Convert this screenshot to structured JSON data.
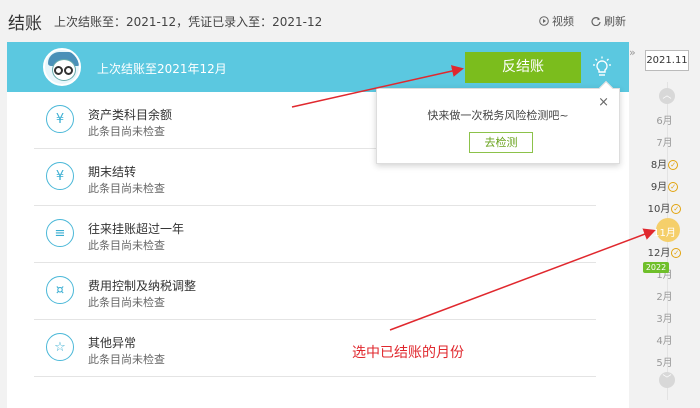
{
  "header": {
    "title": "结账",
    "subtitle": "上次结账至：2021-12，凭证已录入至：2021-12",
    "video_label": "视频",
    "refresh_label": "刷新"
  },
  "banner": {
    "text": "上次结账至2021年12月",
    "unclose_label": "反结账"
  },
  "popup": {
    "message": "快来做一次税务风险检测吧~",
    "button_label": "去检测",
    "close": "×"
  },
  "items": [
    {
      "icon": "yuan-icon",
      "glyph": "¥",
      "name": "资产类科目余额",
      "status": "此条目尚未检查"
    },
    {
      "icon": "document-yuan-icon",
      "glyph": "¥",
      "name": "期末结转",
      "status": "此条目尚未检查"
    },
    {
      "icon": "list-icon",
      "glyph": "≡",
      "name": "往来挂账超过一年",
      "status": "此条目尚未检查"
    },
    {
      "icon": "money-bag-icon",
      "glyph": "¤",
      "name": "费用控制及纳税调整",
      "status": "此条目尚未检查"
    },
    {
      "icon": "star-icon",
      "glyph": "☆",
      "name": "其他异常",
      "status": "此条目尚未检查"
    }
  ],
  "sidebar": {
    "year_label": "2021.11",
    "months": [
      {
        "label": "6月",
        "closed": false
      },
      {
        "label": "7月",
        "closed": false
      },
      {
        "label": "8月",
        "closed": true
      },
      {
        "label": "9月",
        "closed": true
      },
      {
        "label": "10月",
        "closed": true
      },
      {
        "label": "11月",
        "closed": false,
        "selected": true
      },
      {
        "label": "12月",
        "closed": true
      },
      {
        "label": "1月",
        "closed": false
      },
      {
        "label": "2月",
        "closed": false
      },
      {
        "label": "3月",
        "closed": false
      },
      {
        "label": "4月",
        "closed": false
      },
      {
        "label": "5月",
        "closed": false
      }
    ],
    "year_tag": "2022"
  },
  "annotation": "选中已结账的月份",
  "colors": {
    "banner": "#5bc8e0",
    "unclose_button": "#7bbd1d",
    "annotation": "#e0282e",
    "checkmark": "#e2a30d"
  }
}
